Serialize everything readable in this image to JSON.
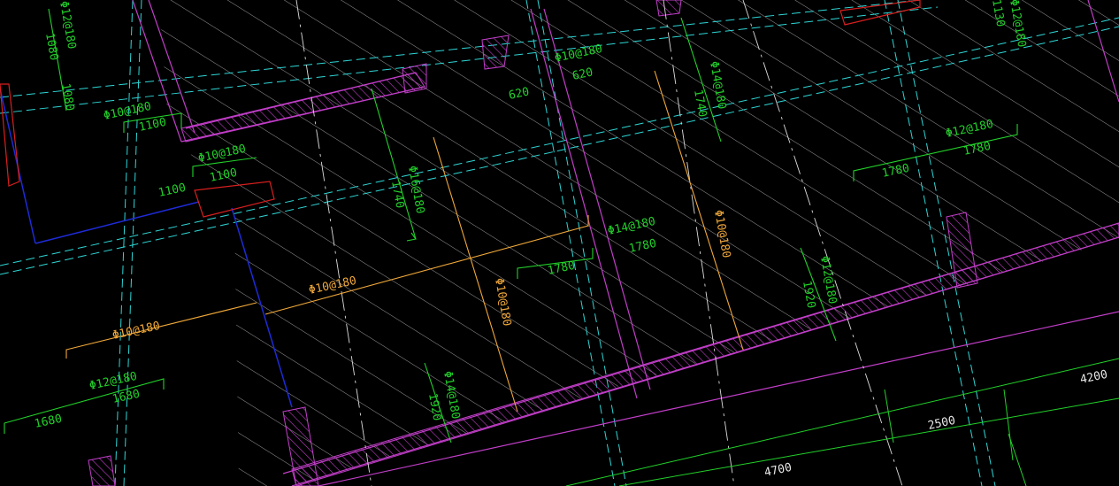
{
  "colors": {
    "background": "#000000",
    "wall_magenta": "#c23ec9",
    "hatch_white": "#cfcfcf",
    "rebar_green": "#22d12a",
    "rebar_orange": "#f0a83a",
    "axis_cyan": "#2fd6d6",
    "beam_blue": "#1e2bd8",
    "marker_red": "#d81f1f",
    "dimension_text": "#e8e8e8"
  },
  "rebar_labels": {
    "top_left_vertical": "Φ12@180",
    "top_left_1080_a": "1080",
    "top_left_1080_b": "1080",
    "left_upper": "Φ10@180",
    "left_upper_len": "1100",
    "left_mid": "Φ10@180",
    "left_mid_len_a": "1100",
    "left_mid_len_b": "1100",
    "center_upper_left": "Φ10@180",
    "center_upper_right": "620",
    "center_upper_left_len": "620",
    "vertical_phi16": "Φ16@180",
    "vertical_phi16_len": "1740",
    "right_vertical_phi14": "Φ14@180",
    "right_vertical_phi14_len": "1740",
    "right_phi12": "Φ12@180",
    "right_phi12_len_a": "1780",
    "right_phi12_len_b": "1780",
    "mid_phi14": "Φ14@180",
    "mid_phi14_len_a": "1780",
    "mid_phi14_len_b": "1780",
    "orange_horizontal_a": "Φ10@180",
    "orange_horizontal_b": "Φ10@180",
    "orange_vertical_a": "Φ10@180",
    "orange_vertical_b": "Φ10@180",
    "lower_phi14": "Φ14@180",
    "lower_phi14_len": "1920",
    "right_lower_phi12": "Φ12@180",
    "right_lower_phi12_len": "1920",
    "bottom_left_phi12": "Φ12@180",
    "bottom_left_len_a": "1680",
    "bottom_left_len_b": "1680",
    "top_right_cut": "Φ12@180",
    "top_right_cut_len": "1130"
  },
  "dimensions": {
    "dim_4200": "4200",
    "dim_2500": "2500",
    "dim_4700": "4700"
  }
}
